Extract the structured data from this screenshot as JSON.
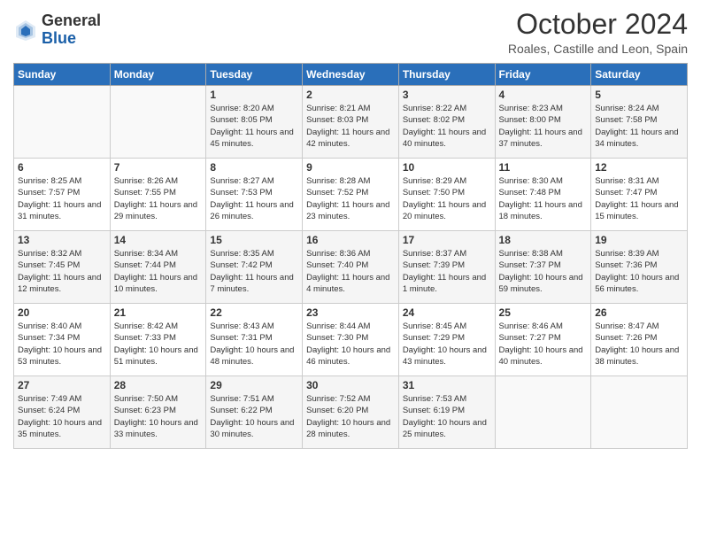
{
  "logo": {
    "general": "General",
    "blue": "Blue"
  },
  "title": "October 2024",
  "location": "Roales, Castille and Leon, Spain",
  "days_of_week": [
    "Sunday",
    "Monday",
    "Tuesday",
    "Wednesday",
    "Thursday",
    "Friday",
    "Saturday"
  ],
  "weeks": [
    [
      {
        "day": "",
        "info": ""
      },
      {
        "day": "",
        "info": ""
      },
      {
        "day": "1",
        "sunrise": "Sunrise: 8:20 AM",
        "sunset": "Sunset: 8:05 PM",
        "daylight": "Daylight: 11 hours and 45 minutes."
      },
      {
        "day": "2",
        "sunrise": "Sunrise: 8:21 AM",
        "sunset": "Sunset: 8:03 PM",
        "daylight": "Daylight: 11 hours and 42 minutes."
      },
      {
        "day": "3",
        "sunrise": "Sunrise: 8:22 AM",
        "sunset": "Sunset: 8:02 PM",
        "daylight": "Daylight: 11 hours and 40 minutes."
      },
      {
        "day": "4",
        "sunrise": "Sunrise: 8:23 AM",
        "sunset": "Sunset: 8:00 PM",
        "daylight": "Daylight: 11 hours and 37 minutes."
      },
      {
        "day": "5",
        "sunrise": "Sunrise: 8:24 AM",
        "sunset": "Sunset: 7:58 PM",
        "daylight": "Daylight: 11 hours and 34 minutes."
      }
    ],
    [
      {
        "day": "6",
        "sunrise": "Sunrise: 8:25 AM",
        "sunset": "Sunset: 7:57 PM",
        "daylight": "Daylight: 11 hours and 31 minutes."
      },
      {
        "day": "7",
        "sunrise": "Sunrise: 8:26 AM",
        "sunset": "Sunset: 7:55 PM",
        "daylight": "Daylight: 11 hours and 29 minutes."
      },
      {
        "day": "8",
        "sunrise": "Sunrise: 8:27 AM",
        "sunset": "Sunset: 7:53 PM",
        "daylight": "Daylight: 11 hours and 26 minutes."
      },
      {
        "day": "9",
        "sunrise": "Sunrise: 8:28 AM",
        "sunset": "Sunset: 7:52 PM",
        "daylight": "Daylight: 11 hours and 23 minutes."
      },
      {
        "day": "10",
        "sunrise": "Sunrise: 8:29 AM",
        "sunset": "Sunset: 7:50 PM",
        "daylight": "Daylight: 11 hours and 20 minutes."
      },
      {
        "day": "11",
        "sunrise": "Sunrise: 8:30 AM",
        "sunset": "Sunset: 7:48 PM",
        "daylight": "Daylight: 11 hours and 18 minutes."
      },
      {
        "day": "12",
        "sunrise": "Sunrise: 8:31 AM",
        "sunset": "Sunset: 7:47 PM",
        "daylight": "Daylight: 11 hours and 15 minutes."
      }
    ],
    [
      {
        "day": "13",
        "sunrise": "Sunrise: 8:32 AM",
        "sunset": "Sunset: 7:45 PM",
        "daylight": "Daylight: 11 hours and 12 minutes."
      },
      {
        "day": "14",
        "sunrise": "Sunrise: 8:34 AM",
        "sunset": "Sunset: 7:44 PM",
        "daylight": "Daylight: 11 hours and 10 minutes."
      },
      {
        "day": "15",
        "sunrise": "Sunrise: 8:35 AM",
        "sunset": "Sunset: 7:42 PM",
        "daylight": "Daylight: 11 hours and 7 minutes."
      },
      {
        "day": "16",
        "sunrise": "Sunrise: 8:36 AM",
        "sunset": "Sunset: 7:40 PM",
        "daylight": "Daylight: 11 hours and 4 minutes."
      },
      {
        "day": "17",
        "sunrise": "Sunrise: 8:37 AM",
        "sunset": "Sunset: 7:39 PM",
        "daylight": "Daylight: 11 hours and 1 minute."
      },
      {
        "day": "18",
        "sunrise": "Sunrise: 8:38 AM",
        "sunset": "Sunset: 7:37 PM",
        "daylight": "Daylight: 10 hours and 59 minutes."
      },
      {
        "day": "19",
        "sunrise": "Sunrise: 8:39 AM",
        "sunset": "Sunset: 7:36 PM",
        "daylight": "Daylight: 10 hours and 56 minutes."
      }
    ],
    [
      {
        "day": "20",
        "sunrise": "Sunrise: 8:40 AM",
        "sunset": "Sunset: 7:34 PM",
        "daylight": "Daylight: 10 hours and 53 minutes."
      },
      {
        "day": "21",
        "sunrise": "Sunrise: 8:42 AM",
        "sunset": "Sunset: 7:33 PM",
        "daylight": "Daylight: 10 hours and 51 minutes."
      },
      {
        "day": "22",
        "sunrise": "Sunrise: 8:43 AM",
        "sunset": "Sunset: 7:31 PM",
        "daylight": "Daylight: 10 hours and 48 minutes."
      },
      {
        "day": "23",
        "sunrise": "Sunrise: 8:44 AM",
        "sunset": "Sunset: 7:30 PM",
        "daylight": "Daylight: 10 hours and 46 minutes."
      },
      {
        "day": "24",
        "sunrise": "Sunrise: 8:45 AM",
        "sunset": "Sunset: 7:29 PM",
        "daylight": "Daylight: 10 hours and 43 minutes."
      },
      {
        "day": "25",
        "sunrise": "Sunrise: 8:46 AM",
        "sunset": "Sunset: 7:27 PM",
        "daylight": "Daylight: 10 hours and 40 minutes."
      },
      {
        "day": "26",
        "sunrise": "Sunrise: 8:47 AM",
        "sunset": "Sunset: 7:26 PM",
        "daylight": "Daylight: 10 hours and 38 minutes."
      }
    ],
    [
      {
        "day": "27",
        "sunrise": "Sunrise: 7:49 AM",
        "sunset": "Sunset: 6:24 PM",
        "daylight": "Daylight: 10 hours and 35 minutes."
      },
      {
        "day": "28",
        "sunrise": "Sunrise: 7:50 AM",
        "sunset": "Sunset: 6:23 PM",
        "daylight": "Daylight: 10 hours and 33 minutes."
      },
      {
        "day": "29",
        "sunrise": "Sunrise: 7:51 AM",
        "sunset": "Sunset: 6:22 PM",
        "daylight": "Daylight: 10 hours and 30 minutes."
      },
      {
        "day": "30",
        "sunrise": "Sunrise: 7:52 AM",
        "sunset": "Sunset: 6:20 PM",
        "daylight": "Daylight: 10 hours and 28 minutes."
      },
      {
        "day": "31",
        "sunrise": "Sunrise: 7:53 AM",
        "sunset": "Sunset: 6:19 PM",
        "daylight": "Daylight: 10 hours and 25 minutes."
      },
      {
        "day": "",
        "info": ""
      },
      {
        "day": "",
        "info": ""
      }
    ]
  ]
}
